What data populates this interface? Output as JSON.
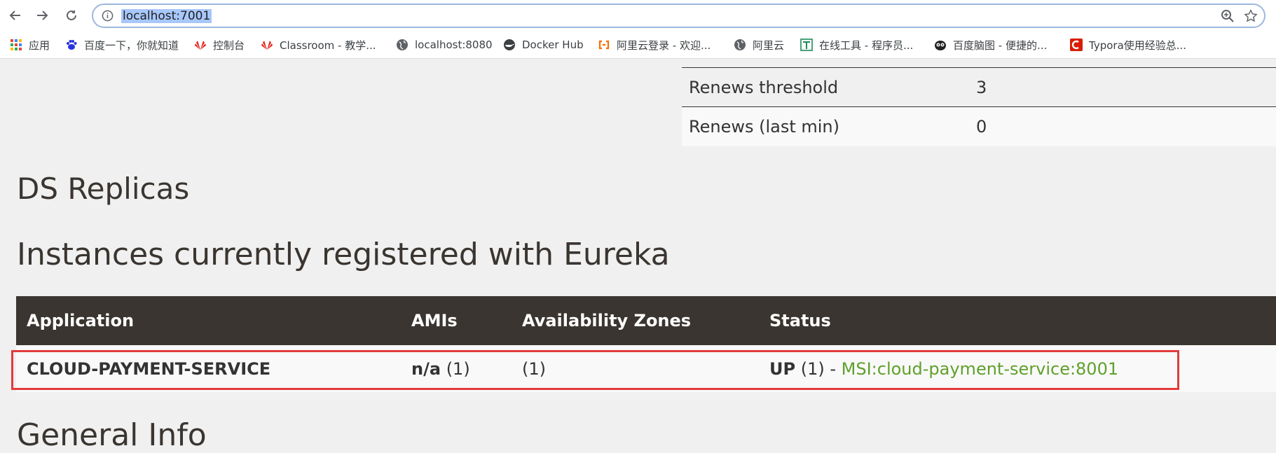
{
  "browser": {
    "url": "localhost:7001",
    "bookmarks": [
      {
        "label": "应用",
        "icon": "apps-grid-icon"
      },
      {
        "label": "百度一下，你就知道",
        "icon": "baidu-paw-icon"
      },
      {
        "label": "控制台",
        "icon": "huawei-icon"
      },
      {
        "label": "Classroom - 教学...",
        "icon": "huawei-icon"
      },
      {
        "label": "localhost:8080",
        "icon": "globe-icon"
      },
      {
        "label": "Docker Hub",
        "icon": "docker-icon"
      },
      {
        "label": "阿里云登录 - 欢迎...",
        "icon": "aliyun-icon"
      },
      {
        "label": "阿里云",
        "icon": "globe-icon"
      },
      {
        "label": "在线工具 - 程序员...",
        "icon": "tool-icon"
      },
      {
        "label": "百度脑图 - 便捷的...",
        "icon": "owl-icon"
      },
      {
        "label": "Typora使用经验总...",
        "icon": "csdn-icon"
      }
    ]
  },
  "stats": [
    {
      "label": "Renews threshold",
      "value": "3"
    },
    {
      "label": "Renews (last min)",
      "value": "0"
    }
  ],
  "headings": {
    "replicas": "DS Replicas",
    "instances": "Instances currently registered with Eureka",
    "general": "General Info"
  },
  "instances_table": {
    "headers": {
      "application": "Application",
      "amis": "AMIs",
      "zones": "Availability Zones",
      "status": "Status"
    },
    "rows": [
      {
        "application": "CLOUD-PAYMENT-SERVICE",
        "amis_value": "n/a",
        "amis_count": "(1)",
        "zones": "(1)",
        "status_value": "UP",
        "status_count": "(1) -",
        "instance_link": "MSI:cloud-payment-service:8001"
      }
    ]
  },
  "colors": {
    "header_bg": "#3a3530",
    "link": "#5fa02a",
    "highlight": "#e23b3b"
  }
}
